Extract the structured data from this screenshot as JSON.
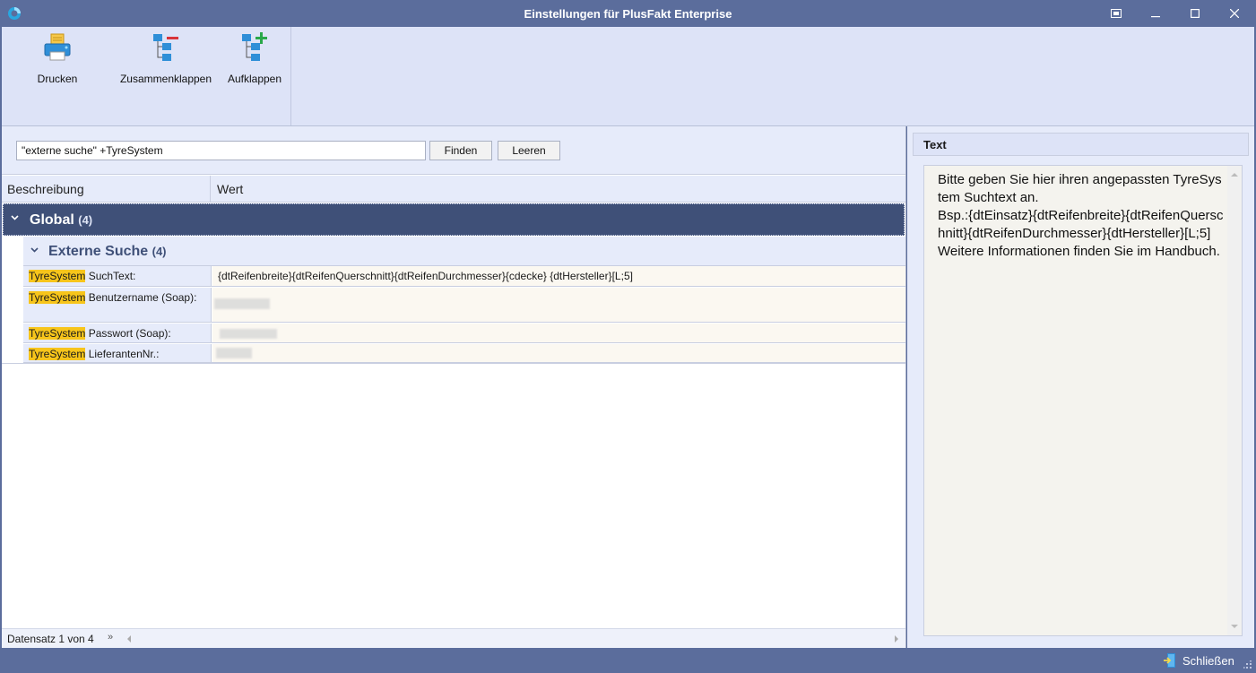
{
  "window": {
    "title": "Einstellungen für PlusFakt Enterprise"
  },
  "ribbon": {
    "buttons": [
      {
        "label": "Drucken",
        "icon": "printer-icon"
      },
      {
        "label": "Zusammenklappen",
        "icon": "collapse-tree-icon"
      },
      {
        "label": "Aufklappen",
        "icon": "expand-tree-icon"
      }
    ]
  },
  "search": {
    "value": "\"externe suche\" +TyreSystem",
    "find_label": "Finden",
    "clear_label": "Leeren"
  },
  "grid": {
    "columns": [
      "Beschreibung",
      "Wert"
    ],
    "group": {
      "title": "Global",
      "count": "(4)"
    },
    "subgroup": {
      "title": "Externe Suche",
      "count": "(4)"
    },
    "rows": [
      {
        "highlight": "TyreSystem",
        "label": " SuchText:",
        "value": "{dtReifenbreite}{dtReifenQuerschnitt}{dtReifenDurchmesser}{cdecke} {dtHersteller}[L;5]"
      },
      {
        "highlight": "TyreSystem",
        "label": " Benutzername (Soap):",
        "value": ""
      },
      {
        "highlight": "TyreSystem",
        "label": " Passwort (Soap):",
        "value": ""
      },
      {
        "highlight": "TyreSystem",
        "label": " LieferantenNr.:",
        "value": ""
      }
    ]
  },
  "status": {
    "record": "Datensatz 1 von 4",
    "nav": "»"
  },
  "text_panel": {
    "header": "Text",
    "body": "Bitte geben Sie hier ihren angepassten TyreSystem Suchtext an.\nBsp.:{dtEinsatz}{dtReifenbreite}{dtReifenQuerschnitt}{dtReifenDurchmesser}{dtHersteller}[L;5]\nWeitere Informationen finden Sie im Handbuch."
  },
  "footer": {
    "close_label": "Schließen"
  },
  "colors": {
    "titlebar": "#5b6d9c",
    "group_header": "#3f5078",
    "highlight": "#f7c51b",
    "ribbon": "#dde3f7"
  }
}
